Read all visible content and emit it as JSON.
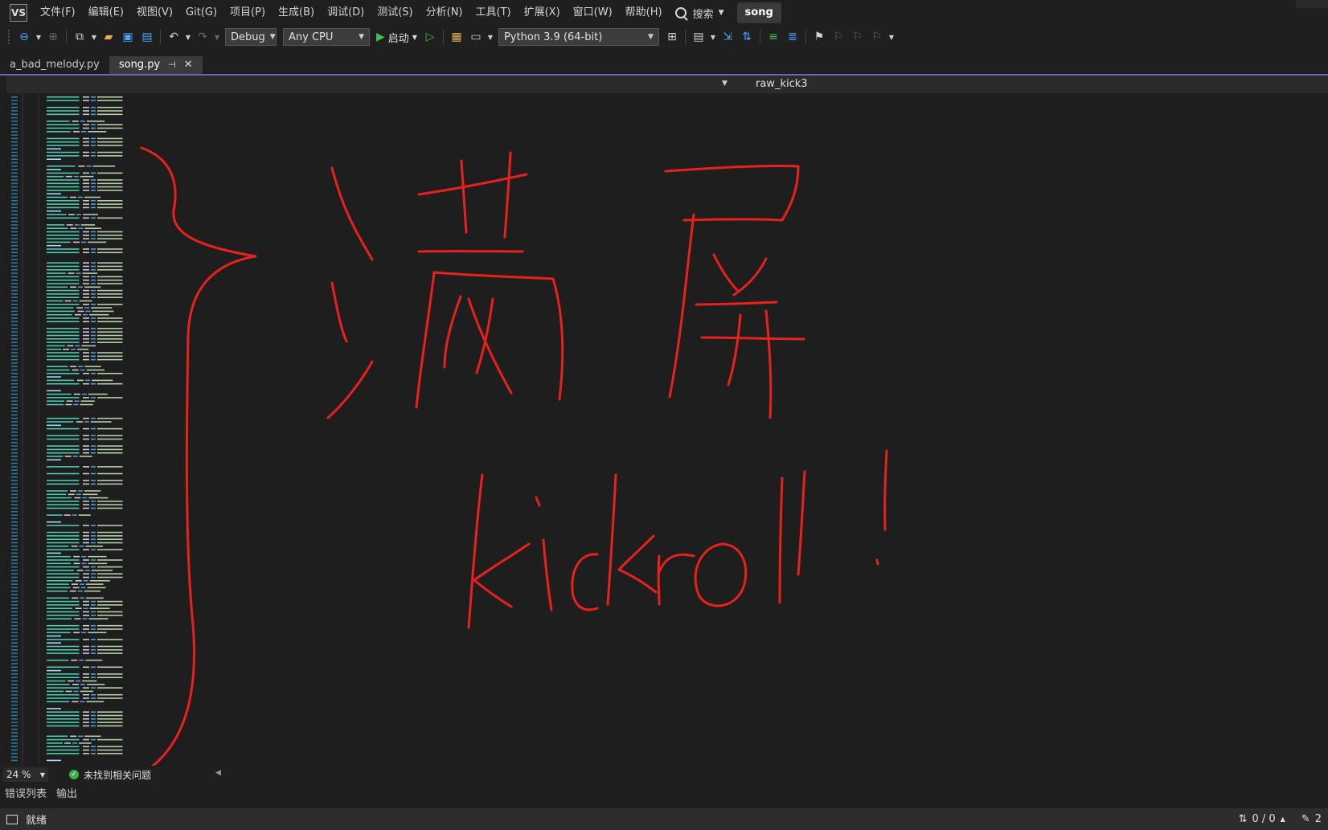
{
  "menu": {
    "logo": "VS",
    "items": [
      "文件(F)",
      "编辑(E)",
      "视图(V)",
      "Git(G)",
      "项目(P)",
      "生成(B)",
      "调试(D)",
      "测试(S)",
      "分析(N)",
      "工具(T)",
      "扩展(X)",
      "窗口(W)",
      "帮助(H)"
    ],
    "search_label": "搜索",
    "solution_name": "song"
  },
  "toolbar": {
    "configuration": "Debug",
    "platform": "Any CPU",
    "start_label": "启动",
    "python_env": "Python 3.9 (64-bit)"
  },
  "tabs": [
    {
      "label": "a_bad_melody.py",
      "active": false
    },
    {
      "label": "song.py",
      "active": true
    }
  ],
  "navbar": {
    "member": "raw_kick3"
  },
  "annotation": {
    "text": "满屏 kickroll !",
    "color": "#e8211c"
  },
  "editor_status": {
    "zoom": "24 %",
    "issues": "未找到相关问题"
  },
  "bottom_tabs": [
    "错误列表",
    "输出"
  ],
  "statusbar": {
    "state": "就绪",
    "line_counter": "0 / 0",
    "pencil_count": "2"
  }
}
